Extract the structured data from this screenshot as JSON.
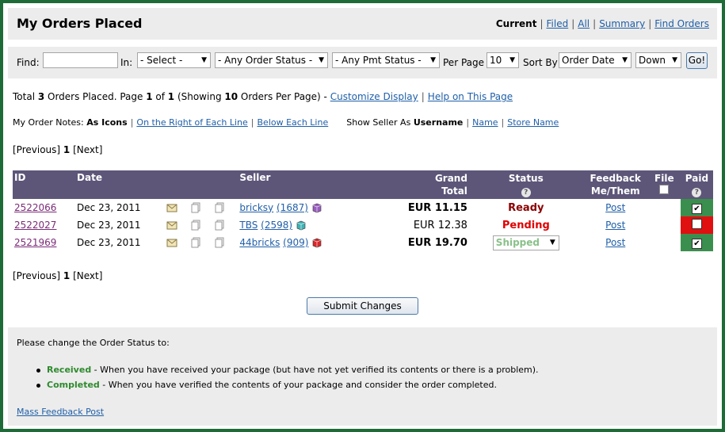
{
  "title": "My Orders Placed",
  "nav": {
    "current": "Current",
    "filed": "Filed",
    "all": "All",
    "summary": "Summary",
    "find_orders": "Find Orders"
  },
  "findbar": {
    "find_label": "Find:",
    "find_value": "",
    "in_label": "In:",
    "in_select": "- Select -",
    "order_status": "- Any Order Status -",
    "pmt_status": "- Any Pmt Status -",
    "per_page_label": "Per Page",
    "per_page": "10",
    "sort_label": "Sort By",
    "sort_by": "Order Date",
    "sort_dir": "Down",
    "go": "Go!"
  },
  "summary": {
    "pre": "Total ",
    "total": "3",
    "mid1": " Orders Placed. Page ",
    "page": "1",
    "mid2": " of ",
    "pages": "1",
    "mid3": " (Showing ",
    "per": "10",
    "mid4": " Orders Per Page) - ",
    "customize": "Customize Display",
    "help": "Help on This Page"
  },
  "notes": {
    "label": "My Order Notes:",
    "as_icons": "As Icons",
    "right": "On the Right of Each Line",
    "below": "Below Each Line",
    "seller_label": "Show Seller As",
    "username": "Username",
    "name": "Name",
    "store": "Store Name"
  },
  "pager": {
    "prev": "[Previous]",
    "page": "1",
    "next": "[Next]"
  },
  "columns": {
    "id": "ID",
    "date": "Date",
    "seller": "Seller",
    "grand": "Grand",
    "total": "Total",
    "status": "Status",
    "feedback": "Feedback",
    "me_them": "Me/Them",
    "file": "File",
    "paid": "Paid"
  },
  "orders": [
    {
      "id": "2522066",
      "date": "Dec 23, 2011",
      "seller": "bricksy",
      "fb": "(1687)",
      "total": "EUR 11.15",
      "status": "Ready",
      "feedback": "Post",
      "paid": true,
      "box_color": "#9a5cc0"
    },
    {
      "id": "2522027",
      "date": "Dec 23, 2011",
      "seller": "TBS",
      "fb": "(2598)",
      "total": "EUR 12.38",
      "status": "Pending",
      "feedback": "Post",
      "paid": false,
      "box_color": "#3fb2b5"
    },
    {
      "id": "2521969",
      "date": "Dec 23, 2011",
      "seller": "44bricks",
      "fb": "(909)",
      "total": "EUR 19.70",
      "status": "Shipped",
      "feedback": "Post",
      "paid": true,
      "box_color": "#d8282a"
    }
  ],
  "submit": "Submit Changes",
  "info": {
    "intro": "Please change the Order Status to:",
    "received": "Received",
    "received_text": " - When you have received your package (but have not yet verified its contents or there is a problem).",
    "completed": "Completed",
    "completed_text": " - When you have verified the contents of your package and consider the order completed.",
    "mass": "Mass Feedback Post"
  },
  "colors": {
    "frame": "#1d6b36",
    "header": "#5d5679",
    "ready": "#8b0000",
    "pending": "#e00000",
    "paid_yes": "#3b8f4e",
    "paid_no": "#e01010"
  }
}
